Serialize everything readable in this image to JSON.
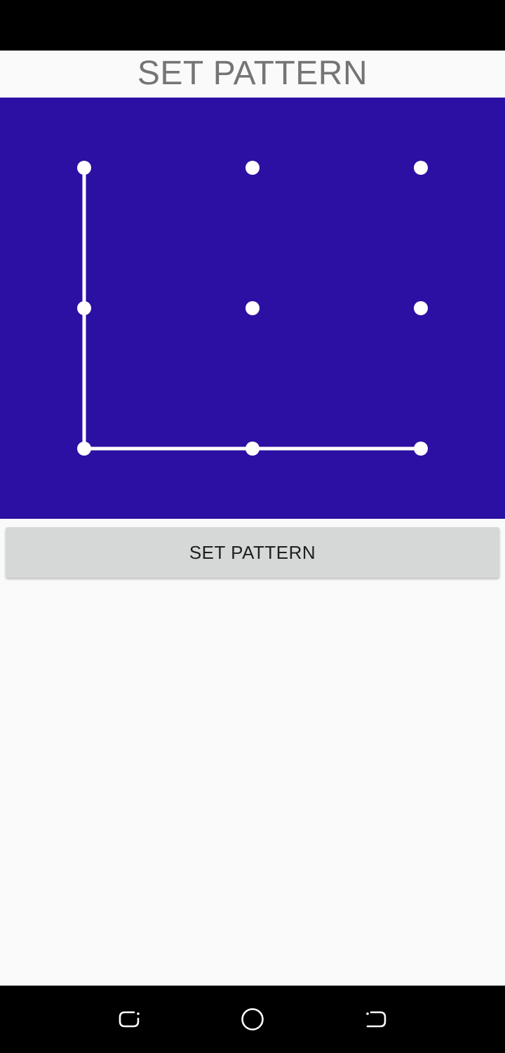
{
  "header": {
    "title": "SET PATTERN"
  },
  "pattern": {
    "background_color": "#2c0fa3",
    "dot_color": "#ffffff",
    "line_color": "#ffffff",
    "grid_size": 3,
    "selected_sequence": [
      1,
      4,
      7,
      8,
      9
    ]
  },
  "actions": {
    "set_pattern_label": "SET PATTERN"
  },
  "navigation": {
    "recent_icon": "recent-apps-icon",
    "home_icon": "home-icon",
    "back_icon": "back-icon"
  }
}
